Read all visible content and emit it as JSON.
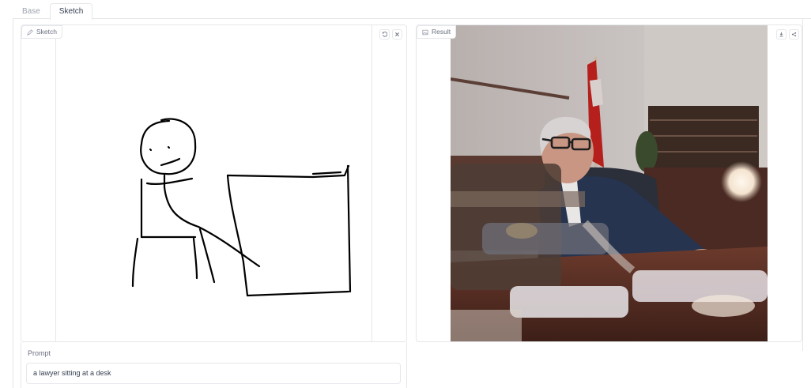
{
  "tabs": [
    {
      "label": "Base",
      "active": false
    },
    {
      "label": "Sketch",
      "active": true
    }
  ],
  "sketch_panel": {
    "label": "Sketch",
    "icon": "pencil-icon",
    "buttons": [
      "undo-icon",
      "clear-icon"
    ]
  },
  "result_panel": {
    "label": "Result",
    "icon": "image-icon",
    "buttons": [
      "download-icon",
      "share-icon"
    ],
    "image_description": "generated photo of a man in a suit seated at a desk"
  },
  "prompt": {
    "label": "Prompt",
    "value": "a lawyer sitting at a desk"
  },
  "colors": {
    "border": "#e5e7eb",
    "label_text": "#6b7280",
    "stroke": "#000000"
  }
}
